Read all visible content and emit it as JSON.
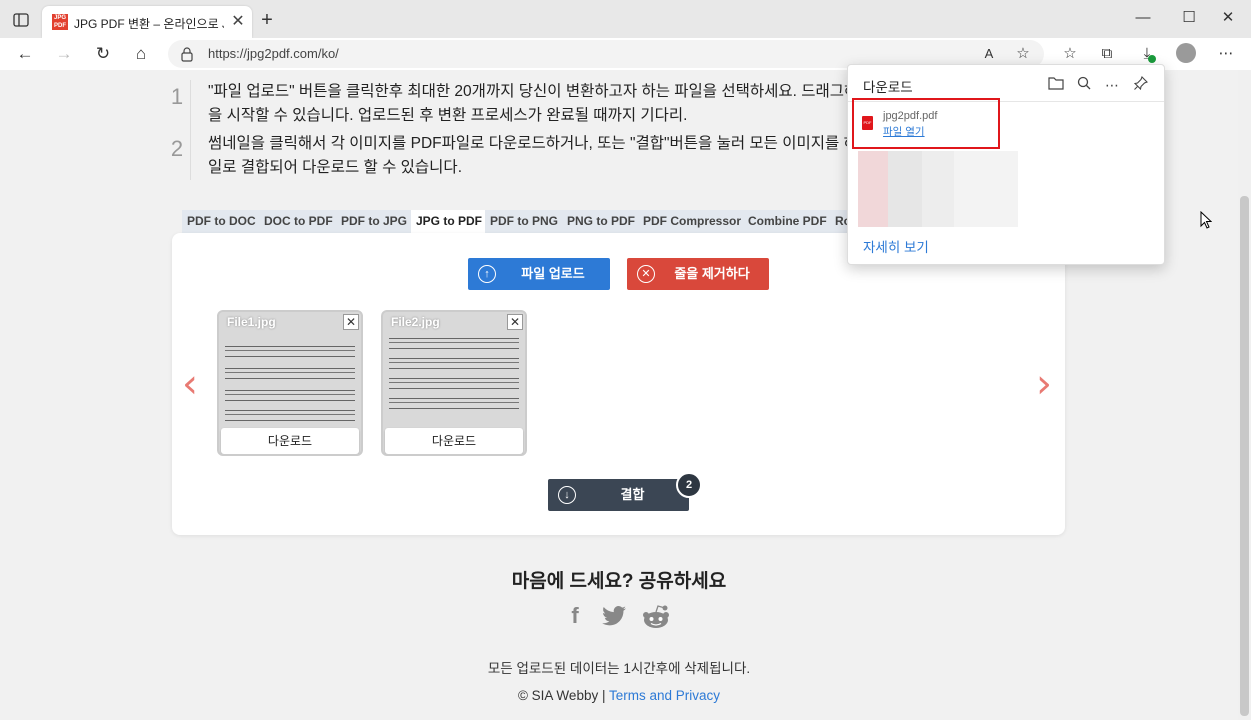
{
  "browser": {
    "tab_title": "JPG PDF 변환 – 온라인으로 JPEG",
    "tab_favicon_text": "JPG PDF",
    "url": "https://jpg2pdf.com/ko/"
  },
  "steps": [
    {
      "num": "1",
      "text": "\"파일 업로드\" 버튼을 클릭한후 최대한 20개까지 당신이 변환하고자 하는 파일을 선택하세요. 드래그해 업로딩을 시작할 수 있습니다. 업로드된 후 변환 프로세스가 완료될 때까지 기다리."
    },
    {
      "num": "2",
      "text": "썸네일을 클릭해서 각 이미지를 PDF파일로 다운로드하거나, 또는 \"결합\"버튼을 눌러 모든 이미지를 하나의 파일로 결합되어 다운로드 할 수 있습니다."
    }
  ],
  "tool_tabs": [
    {
      "label": "PDF to DOC"
    },
    {
      "label": "DOC to PDF"
    },
    {
      "label": "PDF to JPG"
    },
    {
      "label": "JPG to PDF"
    },
    {
      "label": "PDF to PNG"
    },
    {
      "label": "PNG to PDF"
    },
    {
      "label": "PDF Compressor"
    },
    {
      "label": "Combine PDF"
    },
    {
      "label": "Ro"
    }
  ],
  "active_tab": "JPG to PDF",
  "buttons": {
    "upload": "파일 업로드",
    "clear": "줄을 제거하다",
    "merge": "결합",
    "merge_count": "2"
  },
  "files": [
    {
      "name": "File1.jpg",
      "download": "다운로드"
    },
    {
      "name": "File2.jpg",
      "download": "다운로드"
    }
  ],
  "share": {
    "title": "마음에 드세요? 공유하세요",
    "networks": [
      "facebook-icon",
      "twitter-icon",
      "reddit-icon"
    ]
  },
  "footer": {
    "note": "모든 업로드된 데이터는 1시간후에 삭제됩니다.",
    "copyright": "© SIA Webby |",
    "terms": "Terms and Privacy"
  },
  "downloads_panel": {
    "title": "다운로드",
    "file_name": "jpg2pdf.pdf",
    "open_file": "파일 열기",
    "see_more": "자세히 보기"
  },
  "colors": {
    "upload": "#2d7ad6",
    "clear": "#d9483b",
    "merge": "#3b4654",
    "arrow": "#e87a73",
    "highlight": "#e0161b"
  }
}
